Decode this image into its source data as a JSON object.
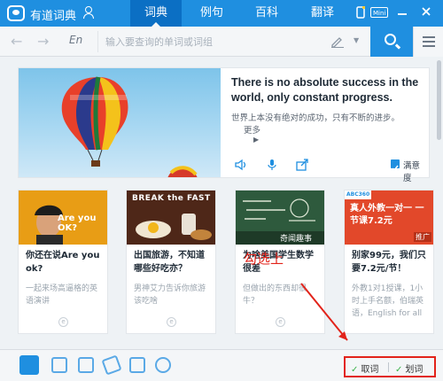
{
  "app": {
    "title": "有道词典"
  },
  "tabs": [
    {
      "label": "词典",
      "active": true
    },
    {
      "label": "例句",
      "active": false
    },
    {
      "label": "百科",
      "active": false
    },
    {
      "label": "翻译",
      "active": false
    }
  ],
  "titlebar_icons": [
    "phone-icon",
    "mini-mode-icon",
    "minimize-icon",
    "close-icon"
  ],
  "titlebar_badge": "Mini",
  "search": {
    "lang_label": "En",
    "placeholder": "输入要查询的单词或词组",
    "value": ""
  },
  "daily": {
    "quote_en": "There is no absolute success in the world, only constant progress.",
    "quote_zh": "世界上本没有绝对的成功，只有不断的进步。",
    "more_label": "更多",
    "fav_label": "满意度",
    "action_icons": [
      "speaker-icon",
      "microphone-icon",
      "share-icon"
    ]
  },
  "cards": [
    {
      "title": "你还在说Are you ok?",
      "subtitle": "一起来场高逼格的英语演讲",
      "image_caption": "Are you OK?"
    },
    {
      "title": "出国旅游，不知道哪些好吃亦？",
      "subtitle": "男神艾力告诉你旅游该吃啥",
      "image_caption": "BREAK the FAST"
    },
    {
      "title": "为啥美国学生数学很差",
      "subtitle": "但做出的东西却很牛？",
      "image_caption": "奇闻趣事"
    },
    {
      "title": "别家99元，我们只要7.2元/节！",
      "subtitle": "外教1对1授课，1小时上手名额，伯瑞英语，English for all",
      "image_caption": "真人外教一对一 一节课7.2元",
      "brand": "ABC360",
      "tag": "推广"
    }
  ],
  "annotation": "勾选上",
  "bottom_icons": [
    "dict-home-icon",
    "word-book-icon",
    "image-icon",
    "pen-icon",
    "document-icon",
    "sync-icon"
  ],
  "bottom_options": [
    {
      "label": "取词",
      "checked": true
    },
    {
      "label": "划词",
      "checked": true
    }
  ],
  "colors": {
    "brand_blue": "#1f8fe0",
    "annotation_red": "#e2231a",
    "check_green": "#3bb34a"
  }
}
